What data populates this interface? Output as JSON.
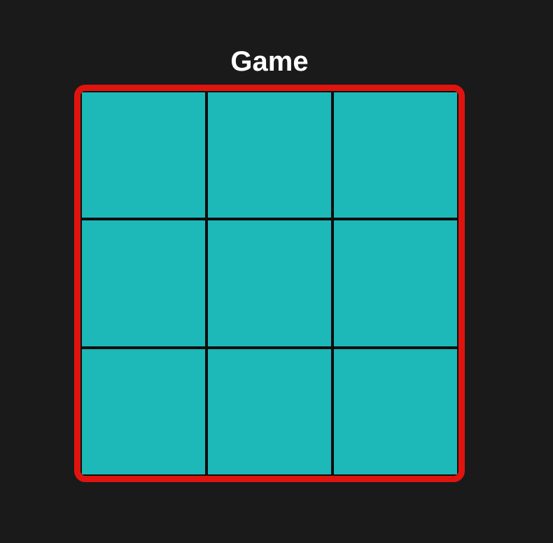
{
  "game": {
    "title": "Game",
    "board": {
      "rows": 3,
      "cols": 3,
      "cells": [
        "",
        "",
        "",
        "",
        "",
        "",
        "",
        "",
        ""
      ]
    }
  },
  "colors": {
    "background": "#1a1a1a",
    "board_border": "#e0140f",
    "cell": "#1db8b8",
    "grid_line": "#0d0d0d",
    "title": "#ffffff"
  }
}
